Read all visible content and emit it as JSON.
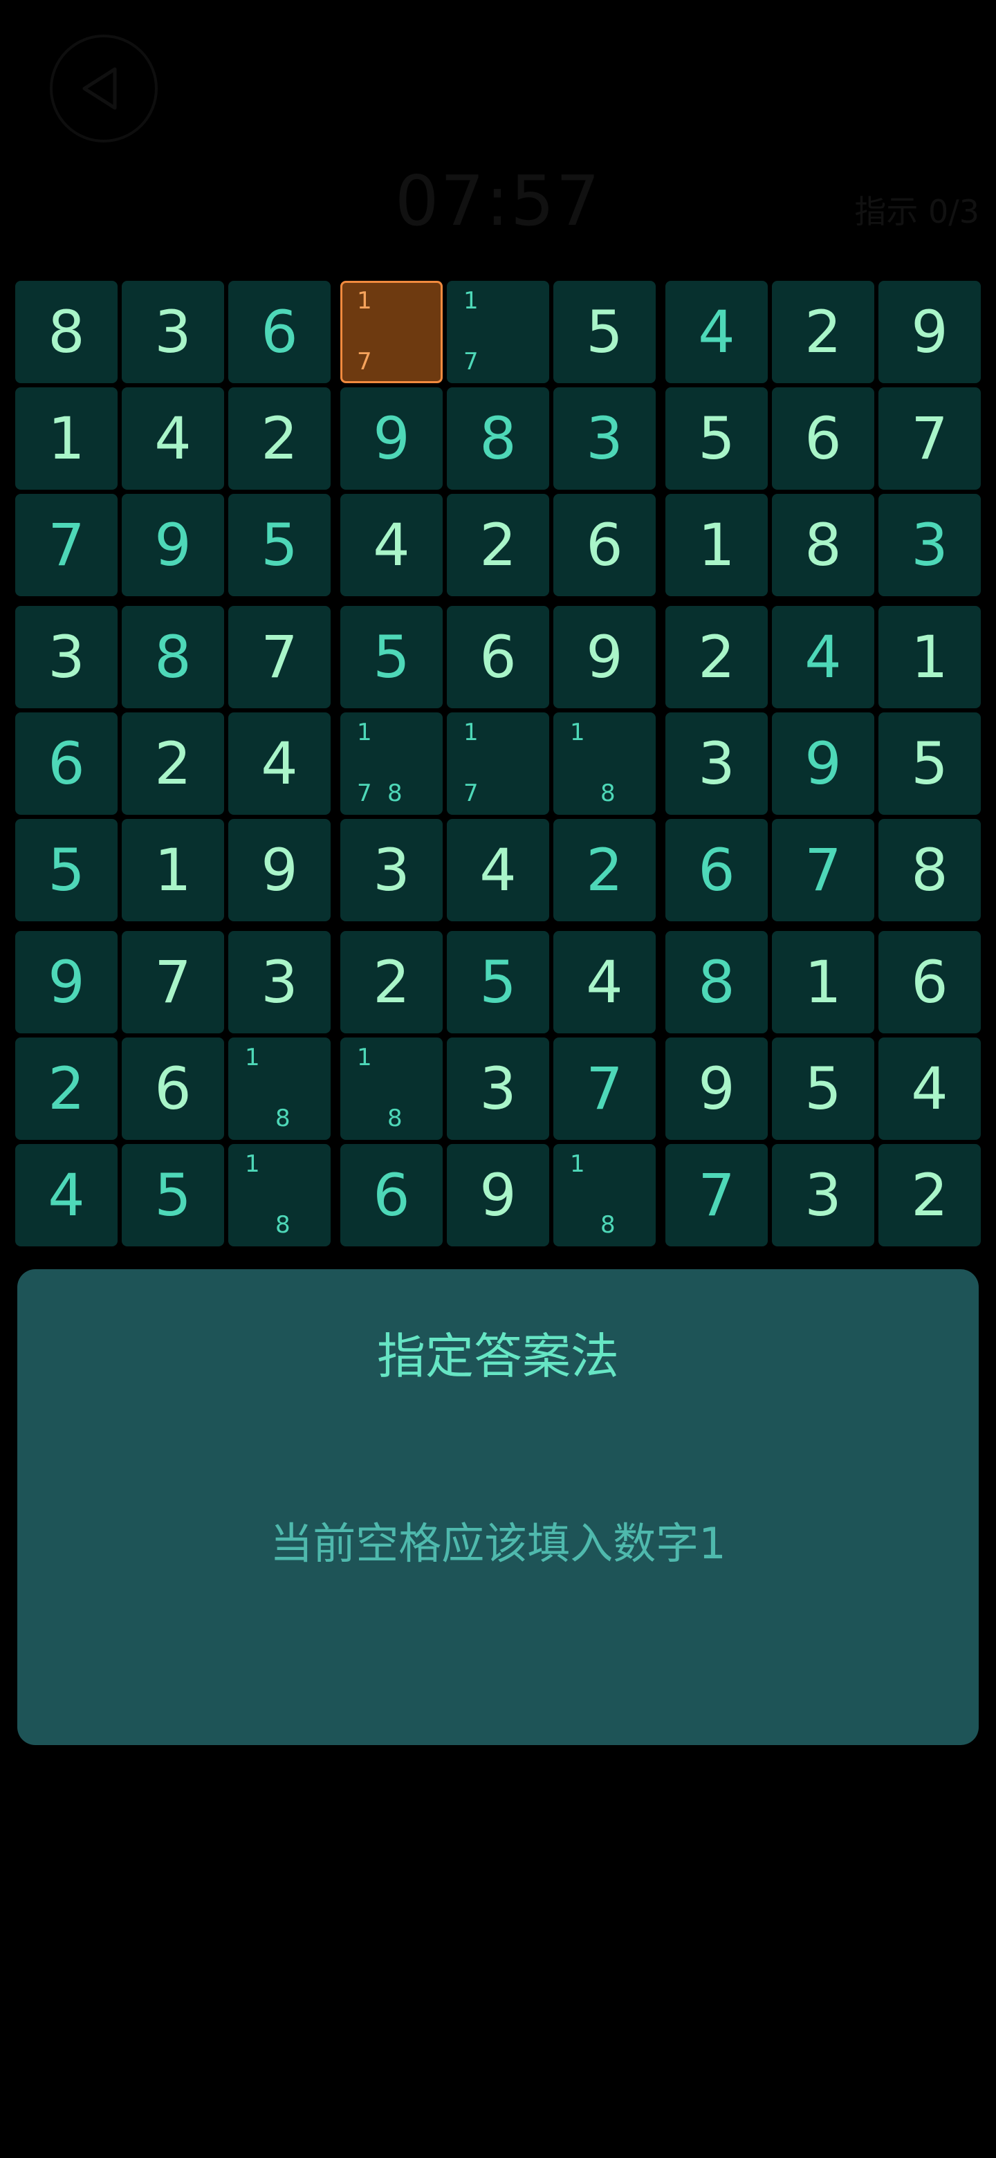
{
  "header": {
    "timer": "07:57",
    "hint_label": "指示 0/3"
  },
  "board": {
    "rows": [
      [
        "8",
        "3",
        "6",
        {
          "c": [
            "1",
            "7"
          ],
          "sel": true
        },
        {
          "c": [
            "1",
            "7"
          ]
        },
        "5",
        "4",
        "2",
        "9"
      ],
      [
        "1",
        "4",
        "2",
        "9",
        "8",
        "3",
        "5",
        "6",
        "7"
      ],
      [
        "7",
        "9",
        "5",
        "4",
        "2",
        "6",
        "1",
        "8",
        "3"
      ],
      [
        "3",
        "8",
        "7",
        "5",
        "6",
        "9",
        "2",
        "4",
        "1"
      ],
      [
        "6",
        "2",
        "4",
        {
          "c": [
            "1",
            "7",
            "8"
          ]
        },
        {
          "c": [
            "1",
            "7"
          ]
        },
        {
          "c": [
            "1",
            "8"
          ]
        },
        "3",
        "9",
        "5"
      ],
      [
        "5",
        "1",
        "9",
        "3",
        "4",
        "2",
        "6",
        "7",
        "8"
      ],
      [
        "9",
        "7",
        "3",
        "2",
        "5",
        "4",
        "8",
        "1",
        "6"
      ],
      [
        "2",
        "6",
        {
          "c": [
            "1",
            "8"
          ]
        },
        {
          "c": [
            "1",
            "8"
          ]
        },
        "3",
        "7",
        "9",
        "5",
        "4"
      ],
      [
        "4",
        "5",
        {
          "c": [
            "1",
            "8"
          ]
        },
        "6",
        "9",
        {
          "c": [
            "1",
            "8"
          ]
        },
        "7",
        "3",
        "2"
      ]
    ],
    "filled_cells": [
      [
        0,
        2
      ],
      [
        0,
        6
      ],
      [
        1,
        3
      ],
      [
        1,
        4
      ],
      [
        1,
        5
      ],
      [
        2,
        0
      ],
      [
        2,
        1
      ],
      [
        2,
        2
      ],
      [
        2,
        8
      ],
      [
        3,
        1
      ],
      [
        3,
        3
      ],
      [
        3,
        7
      ],
      [
        4,
        0
      ],
      [
        4,
        7
      ],
      [
        5,
        0
      ],
      [
        5,
        5
      ],
      [
        5,
        6
      ],
      [
        5,
        7
      ],
      [
        6,
        0
      ],
      [
        6,
        4
      ],
      [
        6,
        6
      ],
      [
        7,
        0
      ],
      [
        7,
        5
      ],
      [
        8,
        0
      ],
      [
        8,
        1
      ],
      [
        8,
        3
      ],
      [
        8,
        6
      ]
    ],
    "colors": {
      "cell_bg": "#07302e",
      "given_text": "#a9f5c9",
      "filled_text": "#4ed8b8",
      "selected_bg": "#6e3a10",
      "selected_border": "#f08a3e"
    }
  },
  "panel": {
    "title": "指定答案法",
    "message": "当前空格应该填入数字1"
  }
}
